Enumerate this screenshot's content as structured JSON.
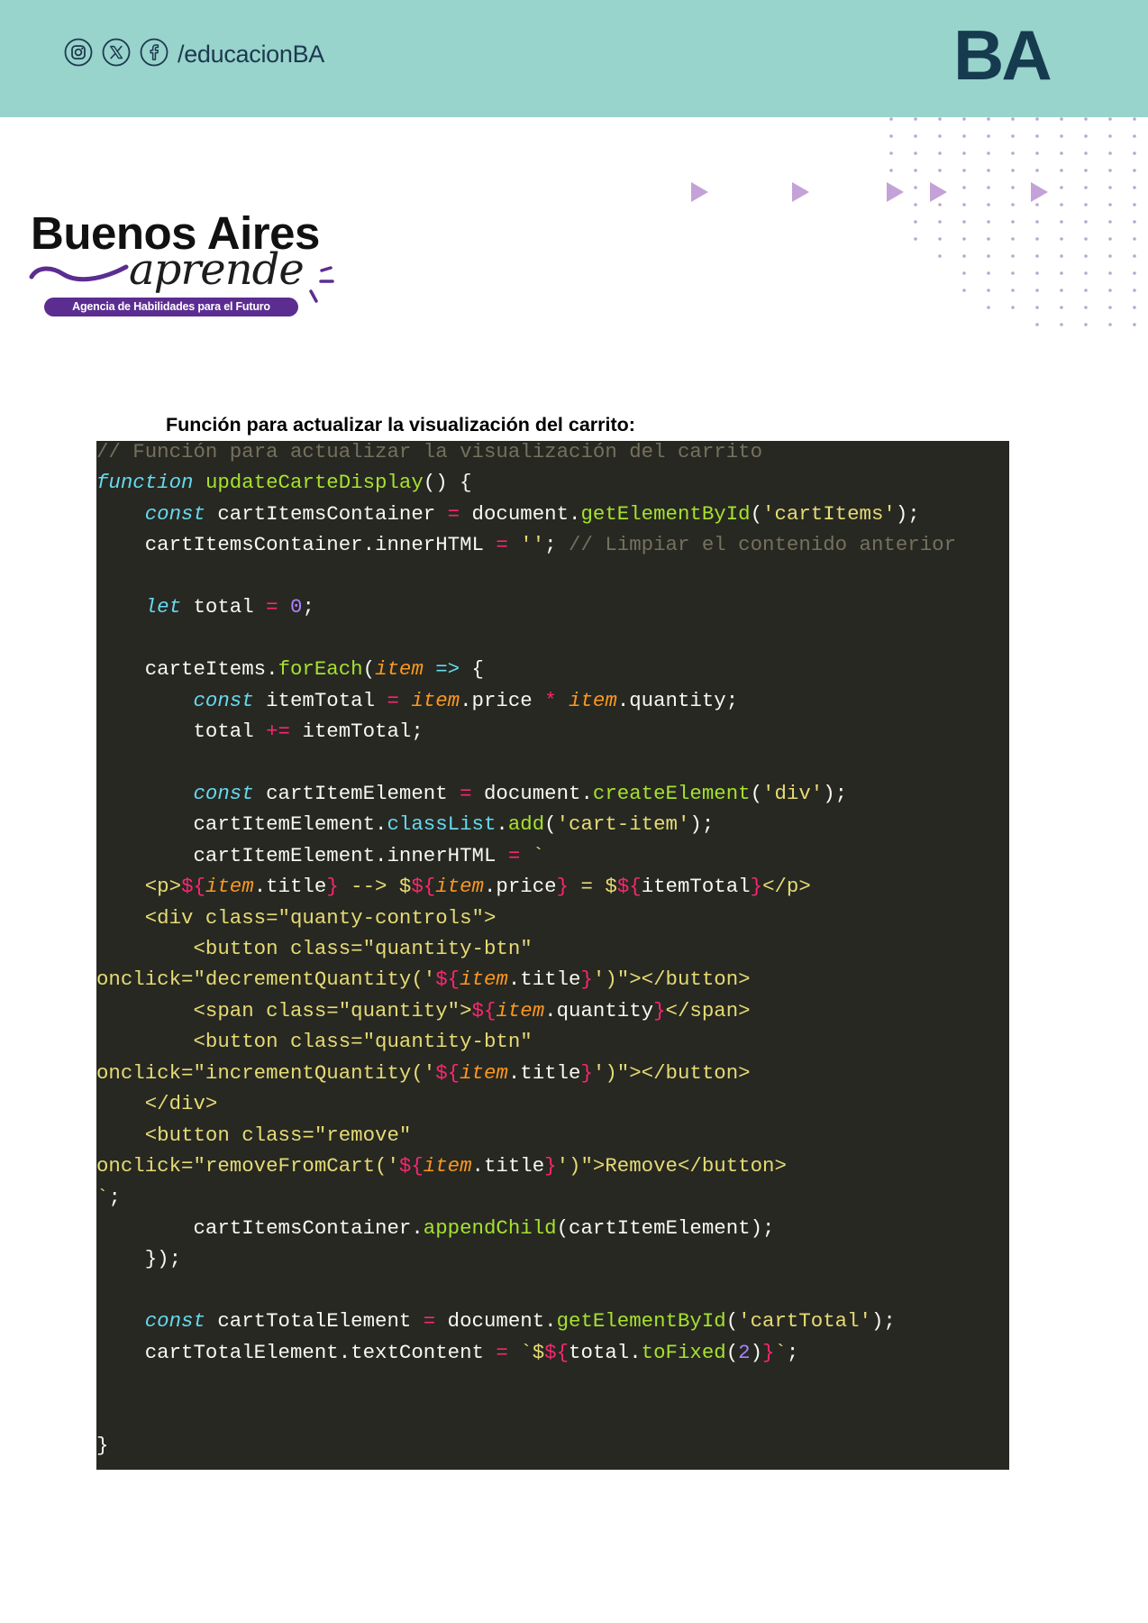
{
  "header": {
    "band_color": "#98d3cc",
    "text_color": "#1c3a4f",
    "logo_color": "#163b4f",
    "social_icons": [
      "instagram-icon",
      "x-icon",
      "facebook-icon"
    ],
    "social_handle": "/educacionBA",
    "logo_text": "BA"
  },
  "brand": {
    "title": "Buenos Aires",
    "script": "aprende",
    "tagline": "Agencia de Habilidades para el Futuro",
    "accent_color": "#5c2d91"
  },
  "decor": {
    "triangle_color": "#c4a2d8",
    "dot_color": "#b9a8cf"
  },
  "section": {
    "heading": "Función para actualizar la visualización del carrito:"
  },
  "code": {
    "language": "javascript",
    "theme": {
      "background": "#272822",
      "text": "#f8f8f2",
      "comment": "#75715e",
      "keyword": "#66d9ef",
      "function": "#a6e22e",
      "operator": "#f92672",
      "string": "#e6db74",
      "number": "#ae81ff",
      "parameter": "#fd971f"
    },
    "lines": [
      [
        [
          "cm",
          "// Función para actualizar la visualización del carrito"
        ]
      ],
      [
        [
          "kw",
          "function"
        ],
        [
          "t",
          " "
        ],
        [
          "fn",
          "updateCarteDisplay"
        ],
        [
          "t",
          "() {"
        ]
      ],
      [
        [
          "t",
          "    "
        ],
        [
          "kw",
          "const"
        ],
        [
          "t",
          " cartItemsContainer "
        ],
        [
          "op",
          "="
        ],
        [
          "t",
          " document."
        ],
        [
          "fn",
          "getElementById"
        ],
        [
          "t",
          "("
        ],
        [
          "str",
          "'cartItems'"
        ],
        [
          "t",
          ");"
        ]
      ],
      [
        [
          "t",
          "    cartItemsContainer.innerHTML "
        ],
        [
          "op",
          "="
        ],
        [
          "t",
          " "
        ],
        [
          "str",
          "''"
        ],
        [
          "t",
          "; "
        ],
        [
          "cm",
          "// Limpiar el contenido anterior"
        ]
      ],
      [],
      [
        [
          "t",
          "    "
        ],
        [
          "kw",
          "let"
        ],
        [
          "t",
          " total "
        ],
        [
          "op",
          "="
        ],
        [
          "t",
          " "
        ],
        [
          "num",
          "0"
        ],
        [
          "t",
          ";"
        ]
      ],
      [],
      [
        [
          "t",
          "    carteItems."
        ],
        [
          "fn",
          "forEach"
        ],
        [
          "t",
          "("
        ],
        [
          "par",
          "item"
        ],
        [
          "t",
          " "
        ],
        [
          "ar",
          "=>"
        ],
        [
          "t",
          " {"
        ]
      ],
      [
        [
          "t",
          "        "
        ],
        [
          "kw",
          "const"
        ],
        [
          "t",
          " itemTotal "
        ],
        [
          "op",
          "="
        ],
        [
          "t",
          " "
        ],
        [
          "par",
          "item"
        ],
        [
          "t",
          ".price "
        ],
        [
          "op",
          "*"
        ],
        [
          "t",
          " "
        ],
        [
          "par",
          "item"
        ],
        [
          "t",
          ".quantity;"
        ]
      ],
      [
        [
          "t",
          "        total "
        ],
        [
          "op",
          "+="
        ],
        [
          "t",
          " itemTotal;"
        ]
      ],
      [],
      [
        [
          "t",
          "        "
        ],
        [
          "kw",
          "const"
        ],
        [
          "t",
          " cartItemElement "
        ],
        [
          "op",
          "="
        ],
        [
          "t",
          " document."
        ],
        [
          "fn",
          "createElement"
        ],
        [
          "t",
          "("
        ],
        [
          "str",
          "'div'"
        ],
        [
          "t",
          ");"
        ]
      ],
      [
        [
          "t",
          "        cartItemElement."
        ],
        [
          "prop",
          "classList"
        ],
        [
          "t",
          "."
        ],
        [
          "fn",
          "add"
        ],
        [
          "t",
          "("
        ],
        [
          "str",
          "'cart-item'"
        ],
        [
          "t",
          ");"
        ]
      ],
      [
        [
          "t",
          "        cartItemElement.innerHTML "
        ],
        [
          "op",
          "="
        ],
        [
          "t",
          " "
        ],
        [
          "str",
          "`"
        ]
      ],
      [
        [
          "str",
          "    <p>"
        ],
        [
          "ip",
          "${"
        ],
        [
          "par",
          "item"
        ],
        [
          "t",
          ".title"
        ],
        [
          "ip",
          "}"
        ],
        [
          "str",
          " --> $"
        ],
        [
          "ip",
          "${"
        ],
        [
          "par",
          "item"
        ],
        [
          "t",
          ".price"
        ],
        [
          "ip",
          "}"
        ],
        [
          "str",
          " = $"
        ],
        [
          "ip",
          "${"
        ],
        [
          "t",
          "itemTotal"
        ],
        [
          "ip",
          "}"
        ],
        [
          "str",
          "</p>"
        ]
      ],
      [
        [
          "str",
          "    <div class=\"quanty-controls\">"
        ]
      ],
      [
        [
          "str",
          "        <button class=\"quantity-btn\""
        ]
      ],
      [
        [
          "str",
          "onclick=\"decrementQuantity('"
        ],
        [
          "ip",
          "${"
        ],
        [
          "par",
          "item"
        ],
        [
          "t",
          ".title"
        ],
        [
          "ip",
          "}"
        ],
        [
          "str",
          "')\"></button>"
        ]
      ],
      [
        [
          "str",
          "        <span class=\"quantity\">"
        ],
        [
          "ip",
          "${"
        ],
        [
          "par",
          "item"
        ],
        [
          "t",
          ".quantity"
        ],
        [
          "ip",
          "}"
        ],
        [
          "str",
          "</span>"
        ]
      ],
      [
        [
          "str",
          "        <button class=\"quantity-btn\""
        ]
      ],
      [
        [
          "str",
          "onclick=\"incrementQuantity('"
        ],
        [
          "ip",
          "${"
        ],
        [
          "par",
          "item"
        ],
        [
          "t",
          ".title"
        ],
        [
          "ip",
          "}"
        ],
        [
          "str",
          "')\"></button>"
        ]
      ],
      [
        [
          "str",
          "    </div>"
        ]
      ],
      [
        [
          "str",
          "    <button class=\"remove\""
        ]
      ],
      [
        [
          "str",
          "onclick=\"removeFromCart('"
        ],
        [
          "ip",
          "${"
        ],
        [
          "par",
          "item"
        ],
        [
          "t",
          ".title"
        ],
        [
          "ip",
          "}"
        ],
        [
          "str",
          "')\">Remove</button>"
        ]
      ],
      [
        [
          "str",
          "`"
        ],
        [
          "t",
          ";"
        ]
      ],
      [
        [
          "t",
          "        cartItemsContainer."
        ],
        [
          "fn",
          "appendChild"
        ],
        [
          "t",
          "(cartItemElement);"
        ]
      ],
      [
        [
          "t",
          "    });"
        ]
      ],
      [],
      [
        [
          "t",
          "    "
        ],
        [
          "kw",
          "const"
        ],
        [
          "t",
          " cartTotalElement "
        ],
        [
          "op",
          "="
        ],
        [
          "t",
          " document."
        ],
        [
          "fn",
          "getElementById"
        ],
        [
          "t",
          "("
        ],
        [
          "str",
          "'cartTotal'"
        ],
        [
          "t",
          ");"
        ]
      ],
      [
        [
          "t",
          "    cartTotalElement.textContent "
        ],
        [
          "op",
          "="
        ],
        [
          "t",
          " "
        ],
        [
          "str",
          "`$"
        ],
        [
          "ip",
          "${"
        ],
        [
          "t",
          "total."
        ],
        [
          "fn",
          "toFixed"
        ],
        [
          "t",
          "("
        ],
        [
          "num",
          "2"
        ],
        [
          "t",
          ")"
        ],
        [
          "ip",
          "}"
        ],
        [
          "str",
          "`"
        ],
        [
          "t",
          ";"
        ]
      ],
      [],
      [],
      [
        [
          "t",
          "}"
        ]
      ]
    ]
  }
}
